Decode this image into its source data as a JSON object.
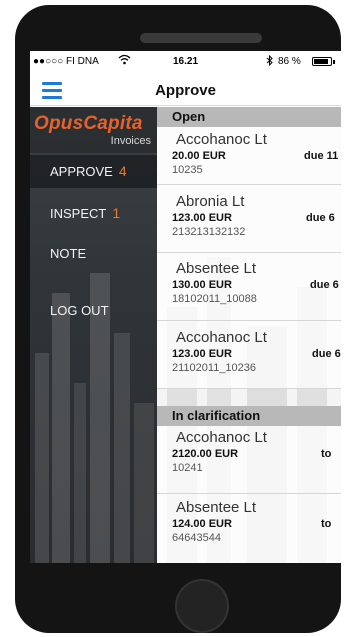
{
  "status_bar": {
    "carrier": "●●○○○ FI DNA",
    "wifi_icon": "wifi-icon",
    "time": "16.21",
    "bluetooth_icon": "bluetooth-icon",
    "battery_percent": "86 %",
    "battery_level": 0.86
  },
  "nav": {
    "menu_icon": "hamburger-icon",
    "title": "Approve"
  },
  "sidebar": {
    "logo_text": "OpusCapita",
    "logo_subtitle": "Invoices",
    "items": [
      {
        "label": "APPROVE",
        "count": "4"
      },
      {
        "label": "INSPECT",
        "count": "1"
      },
      {
        "label": "NOTE",
        "count": ""
      },
      {
        "label": "LOG OUT",
        "count": ""
      }
    ]
  },
  "list": {
    "sections": [
      {
        "title": "Open",
        "invoices": [
          {
            "vendor": "Accohanoc Lt",
            "amount": "20.00 EUR",
            "due": "due 11",
            "ref": "10235"
          },
          {
            "vendor": "Abronia Lt",
            "amount": "123.00 EUR",
            "due": "due 6",
            "ref": "213213132132"
          },
          {
            "vendor": "Absentee Lt",
            "amount": "130.00 EUR",
            "due": "due 6",
            "ref": "18102011_10088"
          },
          {
            "vendor": "Accohanoc Lt",
            "amount": "123.00 EUR",
            "due": "due 6",
            "ref": "21102011_10236"
          }
        ]
      },
      {
        "title": "In clarification",
        "invoices": [
          {
            "vendor": "Accohanoc Lt",
            "amount": "2120.00 EUR",
            "due": "to",
            "ref": "10241"
          },
          {
            "vendor": "Absentee Lt",
            "amount": "124.00 EUR",
            "due": "to",
            "ref": "64643544"
          }
        ]
      }
    ]
  },
  "colors": {
    "accent": "#1e7ad8",
    "brand_orange": "#e8612c",
    "count_orange": "#e87a2a"
  }
}
